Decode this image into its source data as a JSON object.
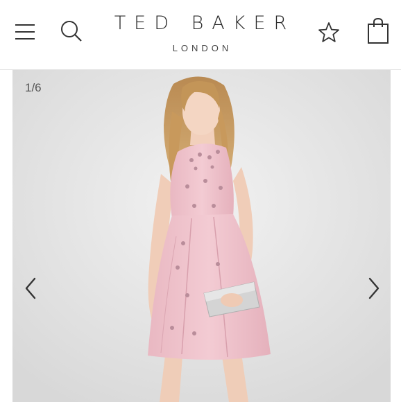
{
  "header": {
    "brand_name": "TED BAKER",
    "brand_sub": "LONDON",
    "icons": {
      "menu": "menu-icon",
      "search": "search-icon",
      "wishlist": "star-icon",
      "bag": "shopping-bag-icon"
    }
  },
  "gallery": {
    "counter": "1/6",
    "product": "pink embellished sleeveless skater dress with silver clutch",
    "icons": {
      "prev": "chevron-left-icon",
      "next": "chevron-right-icon"
    }
  },
  "colors": {
    "text_dark": "#222222",
    "gallery_bg": "#e9e9e9",
    "dress_pink": "#f0c4cd"
  }
}
